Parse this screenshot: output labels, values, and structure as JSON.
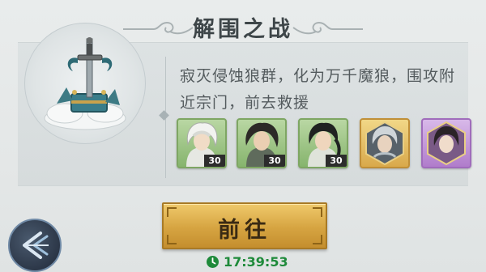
{
  "header": {
    "title": "解围之战"
  },
  "quest": {
    "description": "寂灭侵蚀狼群，化为万千魔狼，围攻附近宗门，前去救援",
    "emblem_icon": "sword-treasure-chest-on-cloud-icon"
  },
  "rewards": [
    {
      "icon": "white-haired-hero-portrait-icon",
      "rarity": "green",
      "level": "30"
    },
    {
      "icon": "dark-haired-hero-portrait-icon",
      "rarity": "green",
      "level": "30"
    },
    {
      "icon": "braided-hero-portrait-icon",
      "rarity": "green",
      "level": "30"
    },
    {
      "icon": "silver-armored-hero-portrait-icon",
      "rarity": "gold",
      "level": ""
    },
    {
      "icon": "violet-hero-portrait-icon",
      "rarity": "purple",
      "level": ""
    }
  ],
  "actions": {
    "go_label": "前往"
  },
  "timer": {
    "icon": "clock-icon",
    "value": "17:39:53"
  },
  "navigation": {
    "back_icon": "back-arrow-icon"
  },
  "colors": {
    "title": "#3e4649",
    "description": "#545b5e",
    "button_gold": "#d6a441",
    "timer_green": "#1e8a3a",
    "card_green": "#86b46d",
    "card_gold": "#d9a94b",
    "card_purple": "#b07ccb"
  }
}
